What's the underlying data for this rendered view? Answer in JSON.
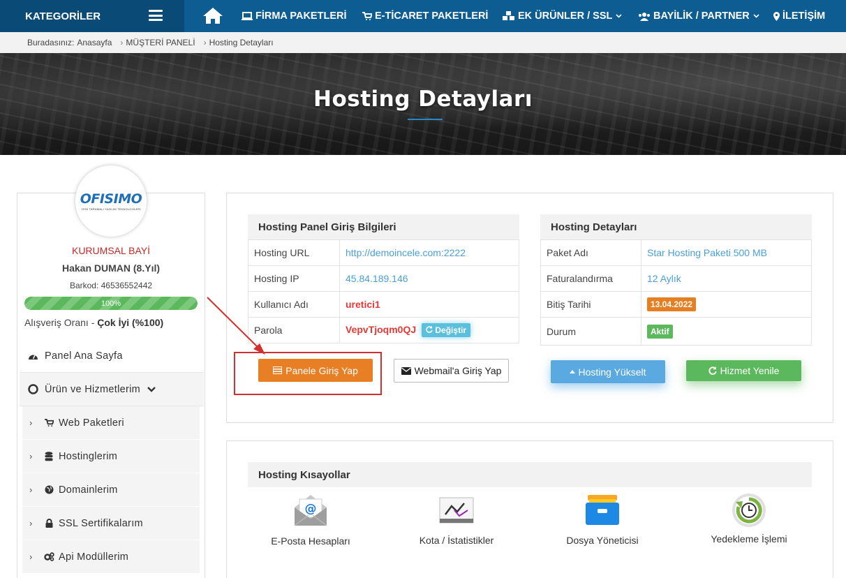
{
  "nav": {
    "categories_label": "KATEGORİLER",
    "items": [
      {
        "label": "FİRMA PAKETLERİ"
      },
      {
        "label": "E-TİCARET PAKETLERİ"
      },
      {
        "label": "EK ÜRÜNLER / SSL"
      },
      {
        "label": "BAYİLİK / PARTNER"
      },
      {
        "label": "İLETİŞİM"
      }
    ]
  },
  "breadcrumb": {
    "prefix": "Buradasınız:",
    "items": [
      "Anasayfa",
      "MÜŞTERİ PANELİ",
      "Hosting Detayları"
    ]
  },
  "hero": {
    "title": "Hosting Detayları"
  },
  "profile": {
    "logo_text": "OFISIMO",
    "logo_sub": "YENİ TARAMALI YAZILIM TEKNOLOJİLERİ",
    "tier": "KURUMSAL BAYİ",
    "name": "Hakan DUMAN (8.Yıl)",
    "barcode": "Barkod: 46536552442",
    "progress": {
      "label": "100%",
      "value": 100
    },
    "rate_label": "Alışveriş Oranı - ",
    "rate_value": "Çok İyi (%100)"
  },
  "menu": {
    "top": [
      {
        "label": "Panel Ana Sayfa"
      },
      {
        "label": "Ürün ve Hizmetlerim"
      }
    ],
    "sub": [
      {
        "label": "Web Paketleri"
      },
      {
        "label": "Hostinglerim"
      },
      {
        "label": "Domainlerim"
      },
      {
        "label": "SSL Sertifikalarım"
      },
      {
        "label": "Api Modüllerim"
      }
    ]
  },
  "login_info": {
    "title": "Hosting Panel Giriş Bilgileri",
    "rows": [
      {
        "key": "Hosting URL",
        "value": "http://demoincele.com:2222"
      },
      {
        "key": "Hosting IP",
        "value": "45.84.189.146"
      },
      {
        "key": "Kullanıcı Adı",
        "value": "uretici1"
      },
      {
        "key": "Parola",
        "value": "VepvTjoqm0QJ"
      }
    ],
    "change_button": "Değiştir",
    "panel_button": "Panele Giriş Yap",
    "webmail_button": "Webmail'a Giriş Yap"
  },
  "details": {
    "title": "Hosting Detayları",
    "rows": [
      {
        "key": "Paket Adı",
        "value": "Star Hosting Paketi 500 MB"
      },
      {
        "key": "Faturalandırma",
        "value": "12 Aylık"
      },
      {
        "key": "Bitiş Tarihi",
        "value": "13.04.2022"
      },
      {
        "key": "Durum",
        "value": "Aktif"
      }
    ],
    "upgrade_button": "Hosting Yükselt",
    "renew_button": "Hizmet Yenile"
  },
  "shortcuts": {
    "title": "Hosting Kısayollar",
    "items": [
      {
        "label": "E-Posta Hesapları",
        "icon": "email-icon"
      },
      {
        "label": "Kota / İstatistikler",
        "icon": "stats-icon"
      },
      {
        "label": "Dosya Yöneticisi",
        "icon": "file-manager-icon"
      },
      {
        "label": "Yedekleme İşlemi",
        "icon": "backup-icon"
      }
    ]
  },
  "colors": {
    "nav": "#0d5d92",
    "link": "#4a9fd8",
    "accent_orange": "#e87f25",
    "success": "#5cb85c",
    "danger": "#d32f2f"
  }
}
